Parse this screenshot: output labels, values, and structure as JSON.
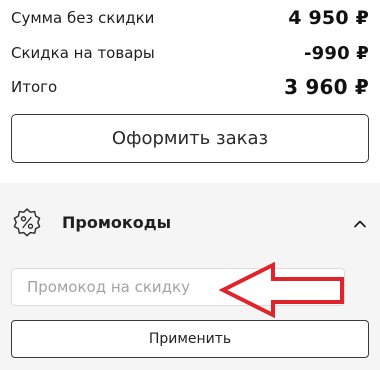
{
  "summary": {
    "subtotal_label": "Сумма без скидки",
    "subtotal_value": "4 950 ₽",
    "discount_label": "Скидка на товары",
    "discount_value": "-990 ₽",
    "total_label": "Итого",
    "total_value": "3 960 ₽",
    "order_button": "Оформить заказ"
  },
  "promo": {
    "icon": "percent-badge-icon",
    "title": "Промокоды",
    "chevron": "chevron-up-icon",
    "input_placeholder": "Промокод на скидку",
    "input_value": "",
    "apply_button": "Применить"
  },
  "annotation": {
    "icon": "red-arrow-left-icon",
    "color": "#e0242b"
  }
}
